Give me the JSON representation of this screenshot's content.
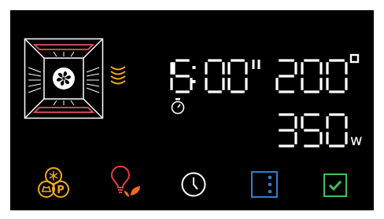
{
  "display": {
    "time": "15:00",
    "time_suffix": "\"",
    "temperature": "200",
    "temperature_unit": "°",
    "power": "350",
    "power_unit": "w"
  },
  "icons": {
    "oven_mode": "oven-fan-heating-icon",
    "radiant_heat": "radiant-heat-waves-icon",
    "timer": "stopwatch-icon",
    "programs": "snowflake-pizza-p-icon",
    "light_eco": "lightbulb-leaf-icon",
    "clock": "clock-icon",
    "menu": "vertical-dots-menu-icon",
    "confirm": "checkmark-icon"
  },
  "colors": {
    "background": "#000000",
    "segment": "#ffffff",
    "heating_element": "#e0545c",
    "heat_wave": "#f2a81d",
    "programs_orange": "#f2a81d",
    "bulb_red": "#e8394a",
    "leaf_orange": "#f26a1d",
    "menu_blue": "#2e7dd1",
    "confirm_green": "#3fbf5a"
  }
}
